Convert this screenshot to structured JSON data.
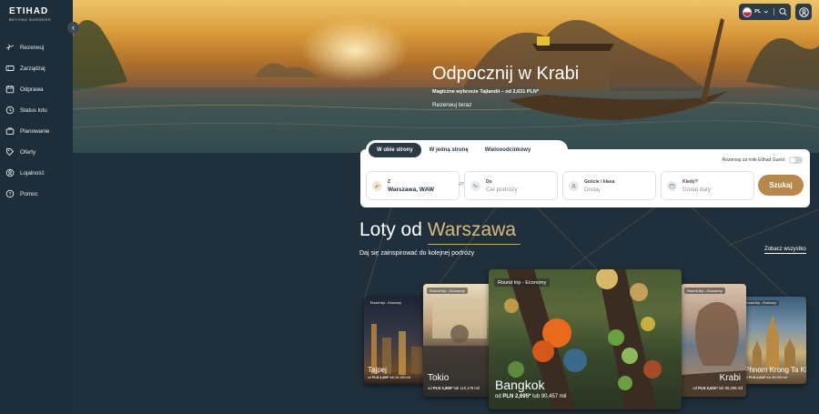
{
  "sidebar": {
    "logo": {
      "line1": "ETIHAD",
      "line2": "BEYOND BORDERS"
    },
    "items": [
      {
        "label": "Rezerwuj",
        "icon": "plane-icon"
      },
      {
        "label": "Zarządzaj",
        "icon": "ticket-icon"
      },
      {
        "label": "Odprawa",
        "icon": "calendar-icon"
      },
      {
        "label": "Status lotu",
        "icon": "clock-icon"
      },
      {
        "label": "Planowanie",
        "icon": "suitcase-icon"
      },
      {
        "label": "Oferty",
        "icon": "tag-icon"
      },
      {
        "label": "Lojalność",
        "icon": "user-circle-icon"
      },
      {
        "label": "Pomoc",
        "icon": "help-icon"
      }
    ]
  },
  "header": {
    "language": "PL"
  },
  "hero": {
    "title": "Odpocznij w Krabi",
    "subtitle": "Magiczne wybrzeże Tajlandii – od 2,631 PLN*",
    "link": "Rezerwuj teraz"
  },
  "booking": {
    "tabs": [
      "W obie strony",
      "W jedną stronę",
      "Wielooodcinkowy"
    ],
    "guest_toggle_label": "Rezerwuj za mile Etihad Guest",
    "from": {
      "label": "Z",
      "value": "Warszawa, WAW"
    },
    "to": {
      "label": "Do",
      "placeholder": "Cel podróży"
    },
    "guests": {
      "label": "Goście i klasa",
      "placeholder": "Dodaj"
    },
    "when": {
      "label": "Kiedy?",
      "placeholder": "Dodaj daty"
    },
    "search": "Szukaj"
  },
  "flights": {
    "title_prefix": "Loty od",
    "city": "Warszawa",
    "subtitle": "Daj się zainspirować do kolejnej podróży",
    "see_all": "Zobacz wszystko",
    "cards": [
      {
        "tag": "Round trip - Economy",
        "city": "Tajpej",
        "from": "od",
        "price": "PLN 3,409*",
        "lub": "lub",
        "miles": "94,155 mil"
      },
      {
        "tag": "Round trip - Economy",
        "city": "Tokio",
        "from": "od",
        "price": "PLN 3,305*",
        "lub": "lub",
        "miles": "110,176 mil"
      },
      {
        "tag": "Round trip - Economy",
        "city": "Bangkok",
        "from": "od",
        "price": "PLN 2,695*",
        "lub": "lub",
        "miles": "90,457 mil"
      },
      {
        "tag": "Round trip - Economy",
        "city": "Krabi",
        "from": "od",
        "price": "PLN 2,631*",
        "lub": "lub",
        "miles": "88,306 mil"
      },
      {
        "tag": "Round trip - Economy",
        "city": "Phnom Krong Ta Khmau",
        "from": "od",
        "price": "PLN 2,644*",
        "lub": "lub",
        "miles": "89,006 mil"
      }
    ]
  }
}
